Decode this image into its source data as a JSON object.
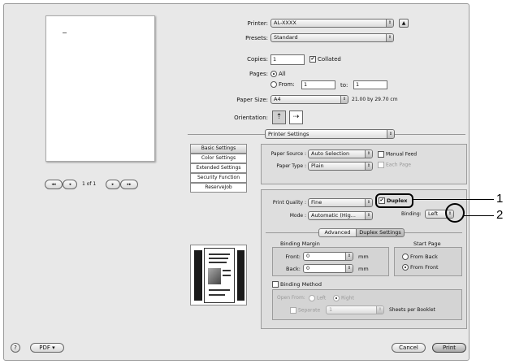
{
  "printer": {
    "label": "Printer:",
    "value": "AL-XXXX"
  },
  "presets": {
    "label": "Presets:",
    "value": "Standard"
  },
  "copies": {
    "label": "Copies:",
    "value": "1",
    "collated_label": "Collated"
  },
  "pages": {
    "label": "Pages:",
    "all_label": "All",
    "from_label": "From:",
    "from_value": "1",
    "to_label": "to:",
    "to_value": "1"
  },
  "paper_size": {
    "label": "Paper Size:",
    "value": "A4",
    "dimensions": "21.00 by 29.70 cm"
  },
  "orientation": {
    "label": "Orientation:"
  },
  "section_select": {
    "value": "Printer Settings"
  },
  "preview": {
    "page_counter": "1 of 1",
    "first": "◂◂",
    "prev": "◂",
    "next": "▸",
    "last": "▸▸"
  },
  "sidebar": {
    "items": [
      "Basic Settings",
      "Color Settings",
      "Extended Settings",
      "Security Function",
      "ReserveJob"
    ]
  },
  "paper_source": {
    "label": "Paper Source :",
    "value": "Auto Selection",
    "manual_feed": "Manual Feed"
  },
  "paper_type": {
    "label": "Paper Type :",
    "value": "Plain",
    "each_page": "Each Page"
  },
  "print_quality": {
    "label": "Print Quality :",
    "value": "Fine",
    "duplex_label": "Duplex"
  },
  "mode": {
    "label": "Mode :",
    "value": "Automatic (Hig..."
  },
  "binding": {
    "label": "Binding:",
    "value": "Left"
  },
  "tabs": [
    "Advanced",
    "Duplex Settings"
  ],
  "binding_margin": {
    "title": "Binding Margin",
    "front_label": "Front:",
    "front_value": "0",
    "back_label": "Back:",
    "back_value": "0",
    "unit": "mm"
  },
  "start_page": {
    "title": "Start Page",
    "from_back": "From Back",
    "from_front": "From Front"
  },
  "binding_method": {
    "label": "Binding Method"
  },
  "open_from": {
    "label": "Open From:",
    "left": "Left",
    "right": "Right"
  },
  "booklet": {
    "separate": "Separate",
    "value": "1",
    "sheets_label": "Sheets per Booklet"
  },
  "footer": {
    "help": "?",
    "pdf": "PDF ▾",
    "cancel": "Cancel",
    "print": "Print"
  },
  "callouts": [
    "1",
    "2"
  ],
  "icons": {
    "printer_toggle": "disclosure-triangle-icon",
    "arrows": "up-down-arrow-icon"
  }
}
